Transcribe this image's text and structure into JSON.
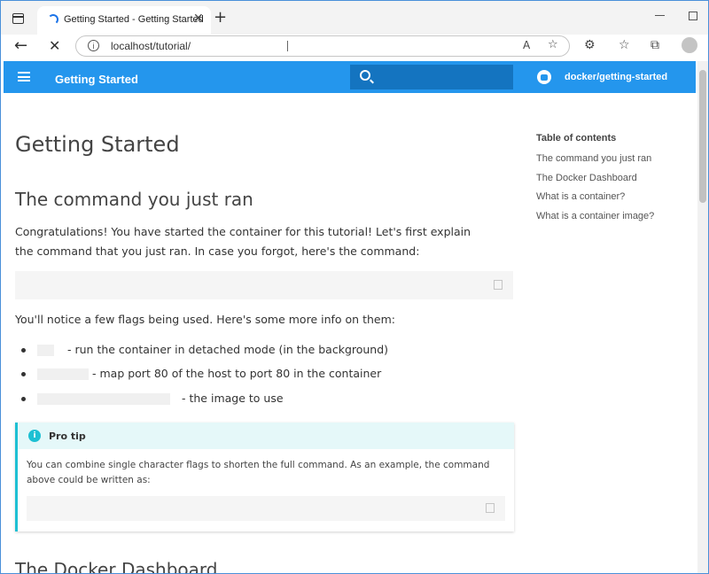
{
  "browser": {
    "tab_title": "Getting Started - Getting Started",
    "tab_close": "✕",
    "new_tab": "+",
    "url": "localhost/tutorial/",
    "back": "←",
    "stop": "✕",
    "info": "i",
    "read_aloud": "A",
    "favorite": "☆",
    "extensions": "⚙",
    "favorites_bar": "☆",
    "collections": "⧉"
  },
  "site": {
    "title": "Getting Started",
    "repo": "docker/getting-started",
    "accent_color": "#2496ed"
  },
  "page": {
    "h1": "Getting Started",
    "section1_title": "The command you just ran",
    "intro": "Congratulations! You have started the container for this tutorial! Let's first explain the command that you just ran. In case you forgot, here's the command:",
    "flags_intro": "You'll notice a few flags being used. Here's some more info on them:",
    "bullets": [
      "- run the container in detached mode (in the background)",
      "- map port 80 of the host to port 80 in the container",
      "- the image to use"
    ],
    "tip_title": "Pro tip",
    "tip_icon": "i",
    "tip_body": "You can combine single character flags to shorten the full command. As an example, the command above could be written as:",
    "section2_title": "The Docker Dashboard"
  },
  "toc": {
    "title": "Table of contents",
    "items": [
      "The command you just ran",
      "The Docker Dashboard",
      "What is a container?",
      "What is a container image?"
    ]
  }
}
